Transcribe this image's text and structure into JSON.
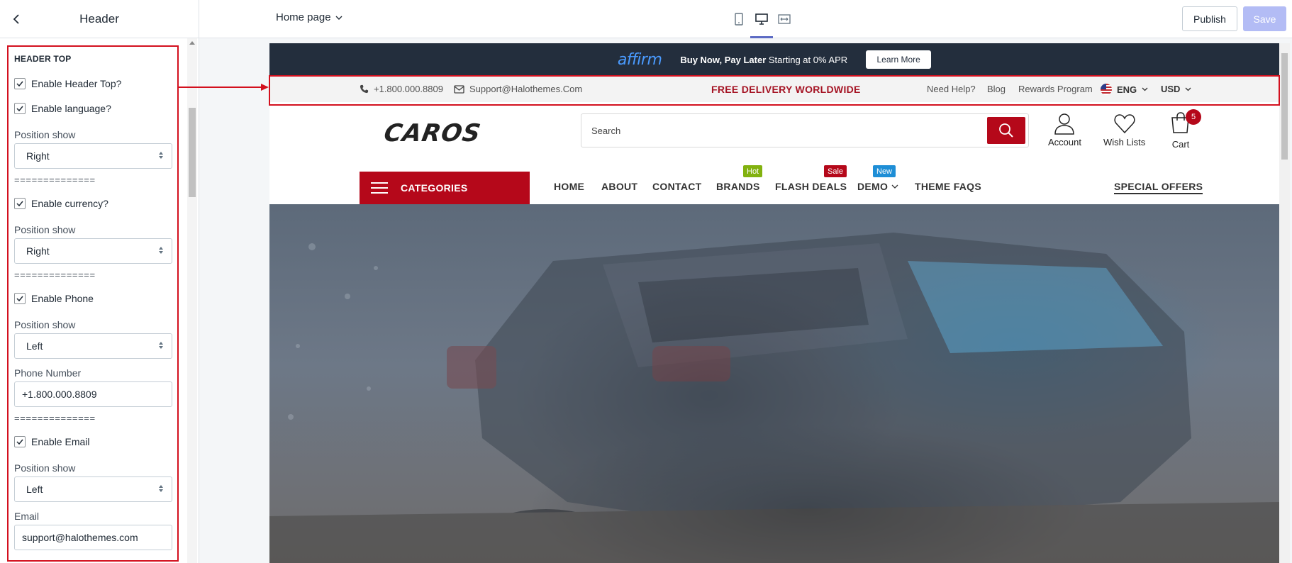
{
  "editor": {
    "panel_title": "Header",
    "page_selector": "Home page",
    "publish_label": "Publish",
    "save_label": "Save"
  },
  "settings": {
    "section_heading": "HEADER TOP",
    "enable_header_top": "Enable Header Top?",
    "enable_language": "Enable language?",
    "language_position_label": "Position show",
    "language_position_value": "Right",
    "separator_1": "==============",
    "enable_currency": "Enable currency?",
    "currency_position_label": "Position show",
    "currency_position_value": "Right",
    "separator_2": "==============",
    "enable_phone": "Enable Phone",
    "phone_position_label": "Position show",
    "phone_position_value": "Left",
    "phone_number_label": "Phone Number",
    "phone_number_value": "+1.800.000.8809",
    "separator_3": "==============",
    "enable_email": "Enable Email",
    "email_position_label": "Position show",
    "email_position_value": "Left",
    "email_label": "Email",
    "email_value": "support@halothemes.com"
  },
  "preview": {
    "promo": {
      "brand": "affirm",
      "text_bold": "Buy Now, Pay Later",
      "text_rest": " Starting at 0% APR",
      "button": "Learn More"
    },
    "top_strip": {
      "phone": "+1.800.000.8809",
      "email": "Support@Halothemes.Com",
      "free_delivery": "FREE DELIVERY WORLDWIDE",
      "need_help": "Need Help?",
      "blog": "Blog",
      "rewards": "Rewards Program",
      "language": "ENG",
      "currency": "USD"
    },
    "header": {
      "logo": "CAROS",
      "search_placeholder": "Search",
      "account": "Account",
      "wishlist": "Wish Lists",
      "cart": "Cart",
      "cart_count": "5"
    },
    "nav": {
      "categories": "CATEGORIES",
      "home": "HOME",
      "about": "ABOUT",
      "contact": "CONTACT",
      "brands": "BRANDS",
      "flash_deals": "FLASH DEALS",
      "demo": "DEMO",
      "theme_faqs": "THEME FAQS",
      "special_offers": "SPECIAL OFFERS",
      "badge_hot": "Hot",
      "badge_sale": "Sale",
      "badge_new": "New"
    }
  },
  "colors": {
    "highlight": "#d3101e",
    "brand_red": "#b5081a",
    "promo_bg": "#232e3d",
    "accent": "#5c6ac4"
  }
}
